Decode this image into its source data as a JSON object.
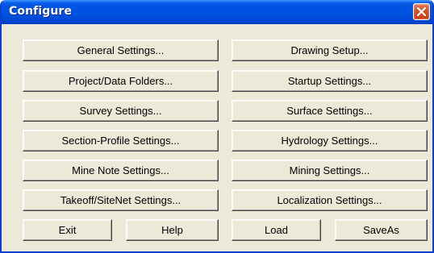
{
  "window": {
    "title": "Configure",
    "close_icon": "close-x-icon",
    "colors": {
      "titlebar": "#0054e3",
      "close_button": "#d64c23",
      "dialog_background": "#ece9d8"
    }
  },
  "buttons": {
    "general_settings": "General Settings...",
    "drawing_setup": "Drawing Setup...",
    "project_data_folders": "Project/Data Folders...",
    "startup_settings": "Startup Settings...",
    "survey_settings": "Survey Settings...",
    "surface_settings": "Surface Settings...",
    "section_profile_settings": "Section-Profile Settings...",
    "hydrology_settings": "Hydrology Settings...",
    "mine_note_settings": "Mine Note Settings...",
    "mining_settings": "Mining Settings...",
    "takeoff_sitenet_settings": "Takeoff/SiteNet Settings...",
    "localization_settings": "Localization Settings...",
    "exit": "Exit",
    "help": "Help",
    "load": "Load",
    "save_as": "SaveAs"
  }
}
